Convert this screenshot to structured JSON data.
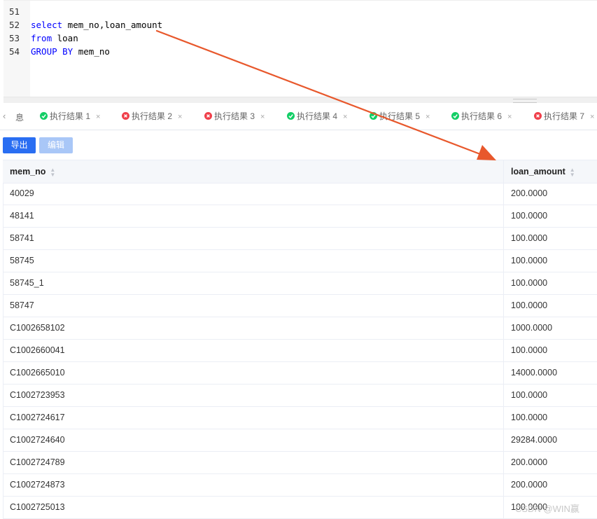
{
  "editor": {
    "lines": [
      {
        "num": "51",
        "tokens": []
      },
      {
        "num": "52",
        "tokens": [
          {
            "t": "select",
            "kw": true
          },
          {
            "t": " mem_no,loan_amount",
            "kw": false
          }
        ]
      },
      {
        "num": "53",
        "tokens": [
          {
            "t": "from",
            "kw": true
          },
          {
            "t": " loan",
            "kw": false
          }
        ]
      },
      {
        "num": "54",
        "tokens": [
          {
            "t": "GROUP BY",
            "kw": true
          },
          {
            "t": " mem_no",
            "kw": false
          }
        ]
      }
    ]
  },
  "tabs": {
    "prev_icon": "chevron-left-icon",
    "cut_label": "息",
    "items": [
      {
        "label": "执行结果 1",
        "status": "success"
      },
      {
        "label": "执行结果 2",
        "status": "error"
      },
      {
        "label": "执行结果 3",
        "status": "error"
      },
      {
        "label": "执行结果 4",
        "status": "success"
      },
      {
        "label": "执行结果 5",
        "status": "success"
      },
      {
        "label": "执行结果 6",
        "status": "success"
      },
      {
        "label": "执行结果 7",
        "status": "error"
      }
    ],
    "close_glyph": "×"
  },
  "toolbar": {
    "export_label": "导出",
    "edit_label": "编辑"
  },
  "table": {
    "columns": [
      "mem_no",
      "loan_amount"
    ],
    "rows": [
      [
        "40029",
        "200.0000"
      ],
      [
        "48141",
        "100.0000"
      ],
      [
        "58741",
        "100.0000"
      ],
      [
        "58745",
        "100.0000"
      ],
      [
        "58745_1",
        "100.0000"
      ],
      [
        "58747",
        "100.0000"
      ],
      [
        "C1002658102",
        "1000.0000"
      ],
      [
        "C1002660041",
        "100.0000"
      ],
      [
        "C1002665010",
        "14000.0000"
      ],
      [
        "C1002723953",
        "100.0000"
      ],
      [
        "C1002724617",
        "100.0000"
      ],
      [
        "C1002724640",
        "29284.0000"
      ],
      [
        "C1002724789",
        "200.0000"
      ],
      [
        "C1002724873",
        "200.0000"
      ],
      [
        "C1002725013",
        "100.0000"
      ]
    ]
  },
  "colors": {
    "accent": "#2a6ef2",
    "success": "#13ce66",
    "error": "#f03f4a",
    "annotation_arrow": "#e8582c"
  },
  "watermark": "CSDN @WIN赢"
}
